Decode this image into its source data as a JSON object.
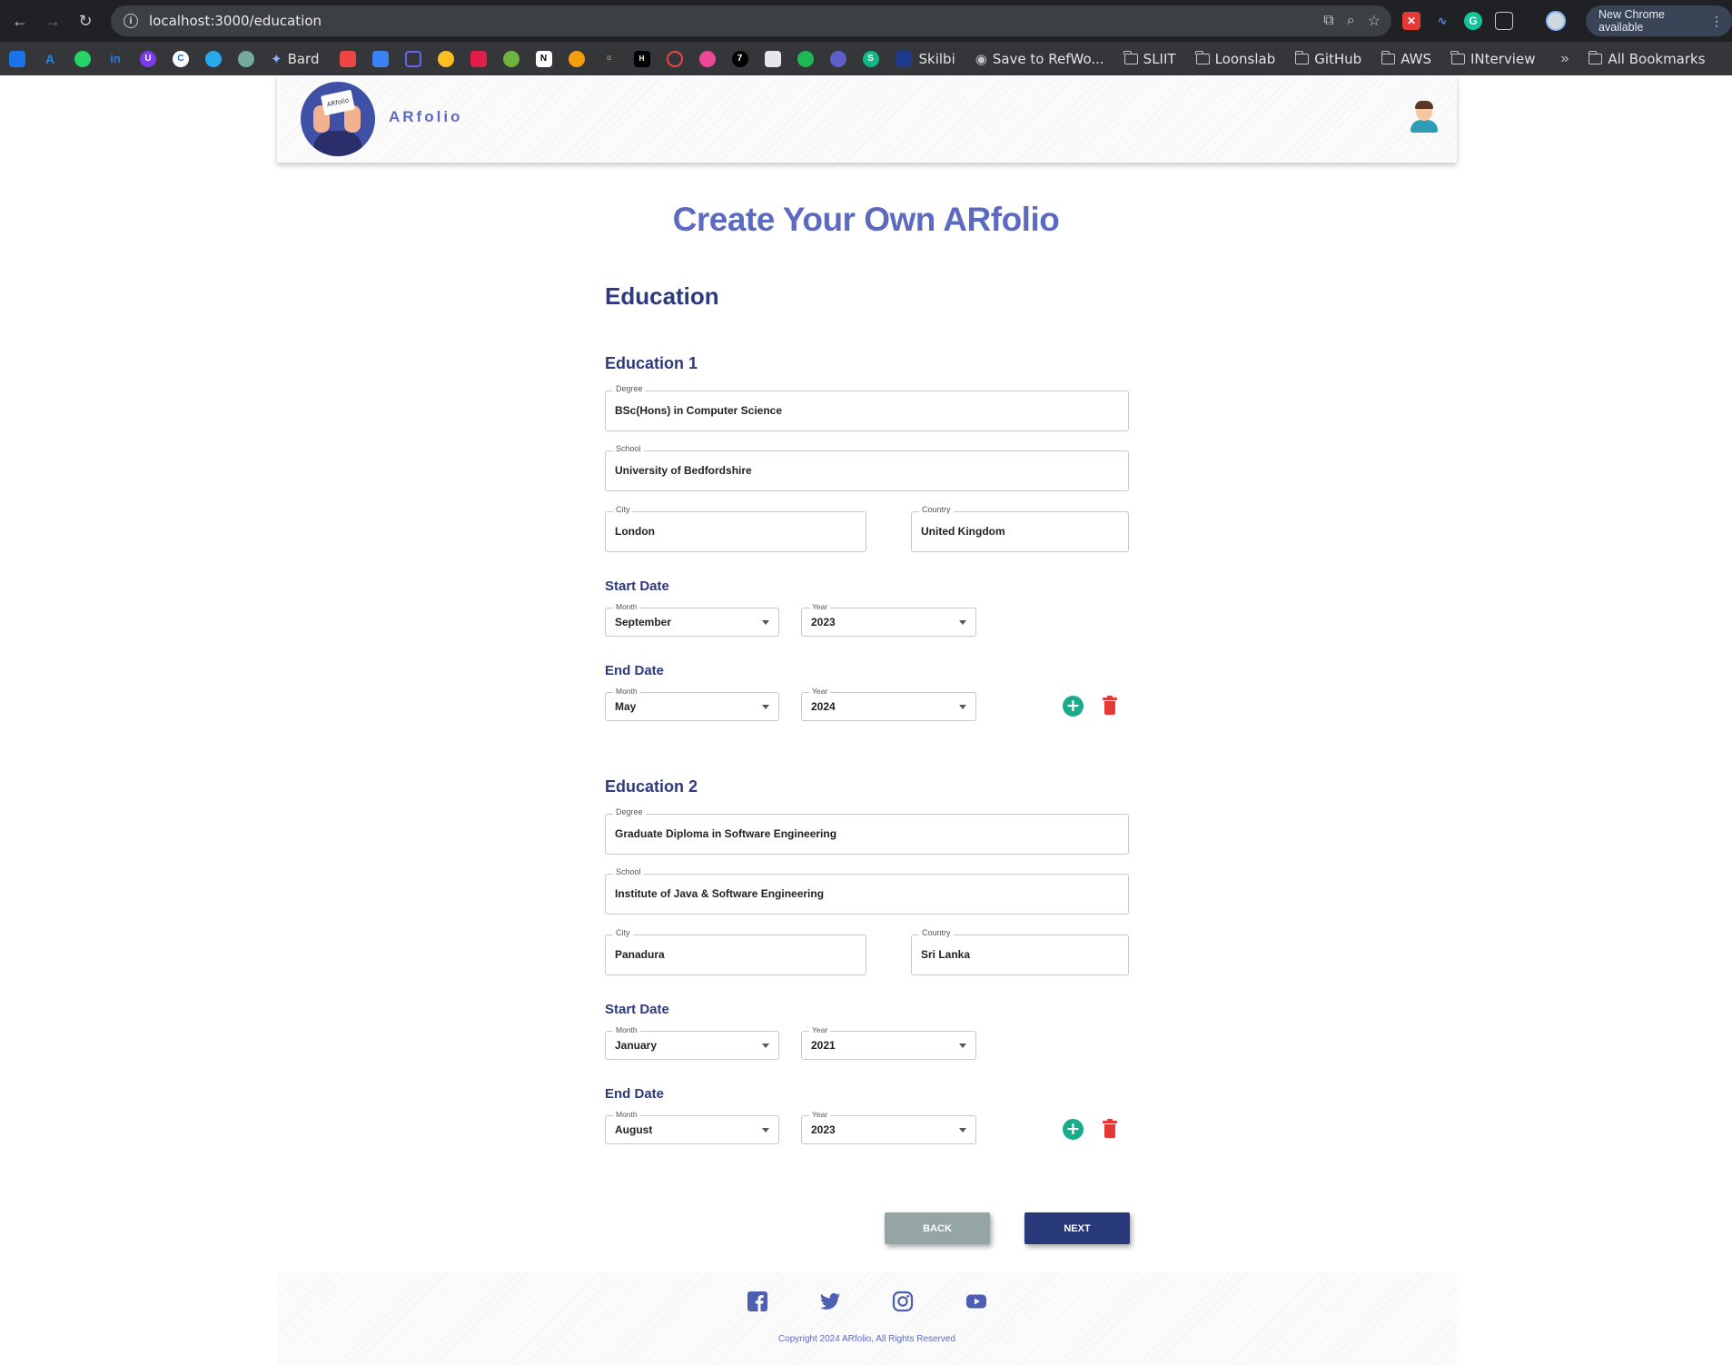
{
  "browser": {
    "url": "localhost:3000/education",
    "update_label": "New Chrome available",
    "bookmarks": [
      "Bard",
      "Skilbi",
      "Save to RefWo...",
      "SLIIT",
      "Loonslab",
      "GitHub",
      "AWS",
      "INterview",
      "All Bookmarks"
    ]
  },
  "header": {
    "brand": "ARfolio",
    "logo_card_text": "ARfolio"
  },
  "page": {
    "title": "Create Your Own ARfolio",
    "section": "Education"
  },
  "labels": {
    "degree": "Degree",
    "school": "School",
    "city": "City",
    "country": "Country",
    "start_date": "Start Date",
    "end_date": "End Date",
    "month": "Month",
    "year": "Year"
  },
  "educations": [
    {
      "heading": "Education 1",
      "degree": "BSc(Hons) in Computer Science",
      "school": "University of Bedfordshire",
      "city": "London",
      "country": "United Kingdom",
      "start_month": "September",
      "start_year": "2023",
      "end_month": "May",
      "end_year": "2024"
    },
    {
      "heading": "Education 2",
      "degree": "Graduate Diploma in Software Engineering",
      "school": "Institute of Java & Software Engineering",
      "city": "Panadura",
      "country": "Sri Lanka",
      "start_month": "January",
      "start_year": "2021",
      "end_month": "August",
      "end_year": "2023"
    }
  ],
  "actions": {
    "back": "BACK",
    "next": "NEXT"
  },
  "footer": {
    "copyright": "Copyright 2024 ARfolio, All Rights Reserved",
    "social_icons": [
      "facebook-icon",
      "twitter-icon",
      "instagram-icon",
      "youtube-icon"
    ]
  },
  "colors": {
    "primary": "#5c6bc0",
    "heading": "#2d3a7c",
    "add": "#1aaa8c",
    "delete": "#e53935",
    "back": "#95a5a6",
    "next": "#283a7a"
  }
}
